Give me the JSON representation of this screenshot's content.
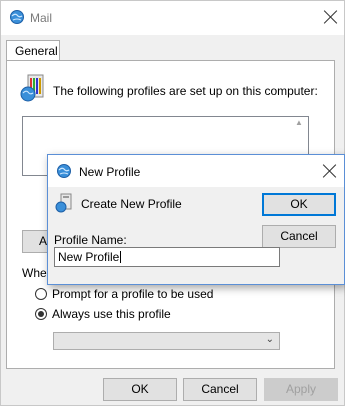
{
  "window": {
    "title": "Mail",
    "icon": "mail-globe-icon",
    "close_icon": "close-icon"
  },
  "tabs": [
    {
      "label": "General",
      "selected": true
    }
  ],
  "general": {
    "profiles_text": "The following profiles are set up on this computer:",
    "profiles_icon": "profiles-icon",
    "add_button_partial": "Ad",
    "when_starting_partial": "Whe",
    "when_starting_tail": "e",
    "radio_prompt": "Prompt for a profile to be used",
    "radio_always": "Always use this profile",
    "selected_profile": ""
  },
  "footer": {
    "ok": "OK",
    "cancel": "Cancel",
    "apply": "Apply"
  },
  "dialog": {
    "title": "New Profile",
    "title_icon": "mail-globe-icon",
    "text": "Create New Profile",
    "text_icon": "profile-card-icon",
    "ok": "OK",
    "cancel": "Cancel",
    "label": "Profile Name:",
    "input_value": "New Profile",
    "close_icon": "close-icon"
  },
  "colors": {
    "accent": "#0078d7",
    "background": "#f0f0f0"
  }
}
